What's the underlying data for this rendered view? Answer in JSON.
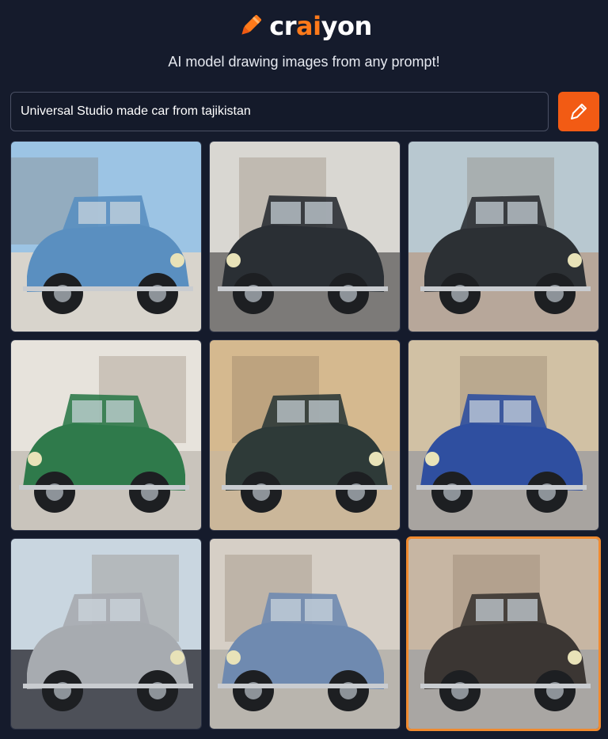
{
  "brand": {
    "prefix": "cr",
    "accent": "ai",
    "suffix": "yon",
    "accent_color": "#ff7a1a",
    "logo_icon": "crayon-pencil-icon"
  },
  "tagline": "AI model drawing images from any prompt!",
  "prompt": {
    "value": "Universal Studio made car from tajikistan"
  },
  "draw_button": {
    "icon": "pencil-icon",
    "color": "#f25b14"
  },
  "results": [
    {
      "id": "image-1",
      "body": "#5a8fc0",
      "sky": "#9cc4e4",
      "ground": "#d8d4cc",
      "selected": false
    },
    {
      "id": "image-2",
      "body": "#2a2f34",
      "sky": "#d9d7d2",
      "ground": "#7c7a78",
      "selected": false
    },
    {
      "id": "image-3",
      "body": "#2c3034",
      "sky": "#b8c8d0",
      "ground": "#b7a79a",
      "selected": false
    },
    {
      "id": "image-4",
      "body": "#2f7a4b",
      "sky": "#e7e3dc",
      "ground": "#c9c4bc",
      "selected": false
    },
    {
      "id": "image-5",
      "body": "#2e3a38",
      "sky": "#d5b98f",
      "ground": "#cbb79a",
      "selected": false
    },
    {
      "id": "image-6",
      "body": "#2f4fa0",
      "sky": "#d1c1a4",
      "ground": "#a8a4a0",
      "selected": false
    },
    {
      "id": "image-7",
      "body": "#a7abb0",
      "sky": "#c9d6e0",
      "ground": "#4d5058",
      "selected": false
    },
    {
      "id": "image-8",
      "body": "#6f8ab0",
      "sky": "#d6cfc6",
      "ground": "#b9b5ae",
      "selected": false
    },
    {
      "id": "image-9",
      "body": "#3b3633",
      "sky": "#c7b6a3",
      "ground": "#a9a6a3",
      "selected": true
    }
  ]
}
